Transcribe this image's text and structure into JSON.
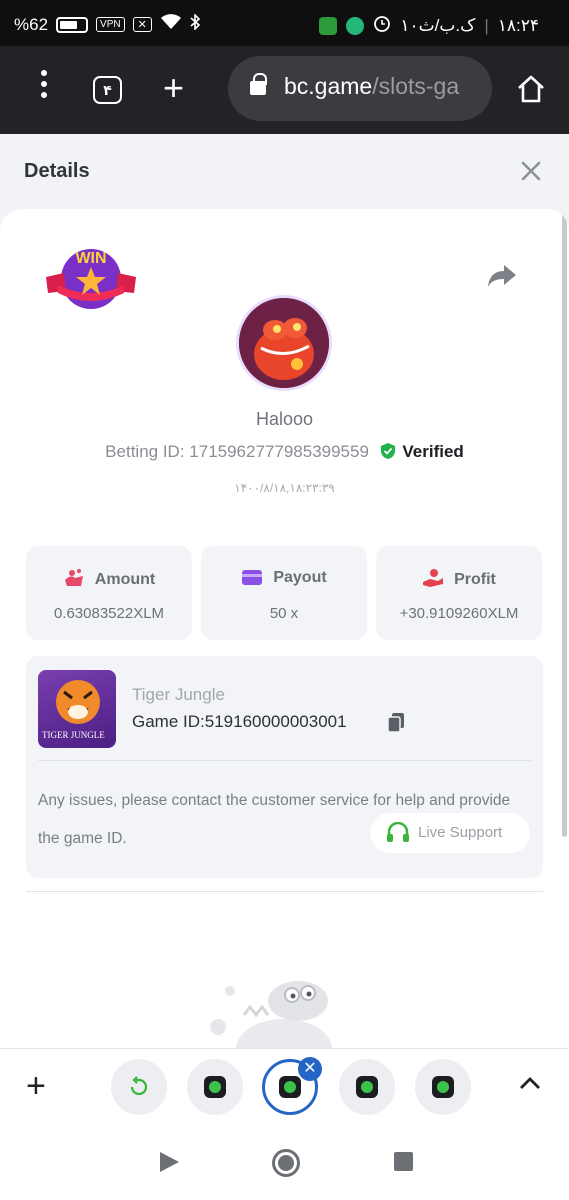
{
  "status_bar": {
    "battery": "%62",
    "vpn": "VPN",
    "time": "۱۸:۲۴",
    "date": "۱۰ک.ب/ث"
  },
  "browser": {
    "tab_count": "۴",
    "url_host": "bc.game",
    "url_path": "/slots-ga"
  },
  "modal": {
    "title": "Details"
  },
  "bet": {
    "username": "Halooo",
    "betting_id_label": "Betting ID: ",
    "betting_id": "1715962777985399559",
    "verified_label": "Verified",
    "time": "۱۴۰۰/۸/۱۸,۱۸:۲۳:۳۹"
  },
  "stats": [
    {
      "label": "Amount",
      "value": "0.63083522XLM"
    },
    {
      "label": "Payout",
      "value": "50 x"
    },
    {
      "label": "Profit",
      "value": "+30.9109260XLM"
    }
  ],
  "game": {
    "name": "Tiger Jungle",
    "id_label": "Game ID:",
    "id": "519160000003001",
    "thumb_text": "TIGER JUNGLE",
    "issue_text": "Any issues, please contact the customer service for help and provide the game ID.",
    "live_support": "Live Support"
  },
  "badge": {
    "win_text": "WIN"
  },
  "colors": {
    "accent": "#2565c6",
    "verified": "#22b24c",
    "amount_icon": "#e5486b",
    "payout_icon": "#8c4fe6",
    "profit_icon": "#e5404f"
  }
}
